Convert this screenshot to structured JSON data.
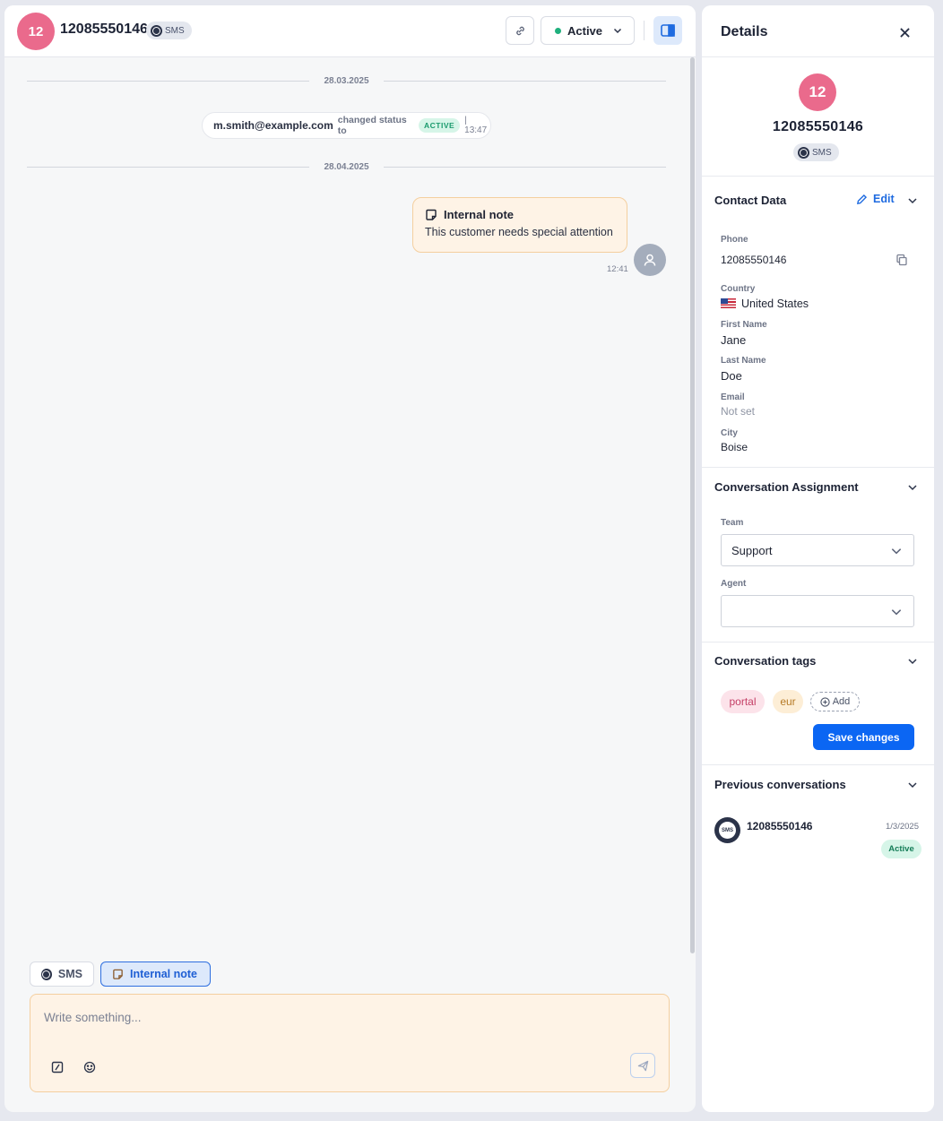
{
  "conversation": {
    "avatar_initials": "12",
    "title": "12085550146",
    "channel_badge": "SMS",
    "status_label": "Active"
  },
  "timeline": {
    "date_1": "28.03.2025",
    "system_message": {
      "actor": "m.smith@example.com",
      "text": "changed status to",
      "status": "ACTIVE",
      "time": "| 13:47"
    },
    "date_2": "28.04.2025",
    "note": {
      "title": "Internal note",
      "text": "This customer needs special attention",
      "time": "12:41"
    }
  },
  "composer": {
    "tab_sms": "SMS",
    "tab_note": "Internal note",
    "placeholder": "Write something..."
  },
  "details": {
    "title": "Details",
    "avatar_initials": "12",
    "number": "12085550146",
    "channel_badge": "SMS",
    "contact": {
      "section_title": "Contact Data",
      "edit_label": "Edit",
      "phone_label": "Phone",
      "phone": "12085550146",
      "country_label": "Country",
      "country": "United States",
      "first_name_label": "First Name",
      "first_name": "Jane",
      "last_name_label": "Last Name",
      "last_name": "Doe",
      "email_label": "Email",
      "email": "Not set",
      "city_label": "City",
      "city": "Boise"
    },
    "assignment": {
      "section_title": "Conversation Assignment",
      "team_label": "Team",
      "team_value": "Support",
      "agent_label": "Agent",
      "agent_value": ""
    },
    "tags": {
      "section_title": "Conversation tags",
      "items": [
        "portal",
        "eur"
      ],
      "add_label": "Add",
      "save_label": "Save changes"
    },
    "previous": {
      "section_title": "Previous conversations",
      "items": [
        {
          "icon_text": "SMS",
          "number": "12085550146",
          "date": "1/3/2025",
          "status": "Active"
        }
      ]
    }
  },
  "colors": {
    "primary": "#0b66f3",
    "avatar": "#ea6a8c",
    "active_green": "#1fb07d",
    "note_bg": "#fef3e6",
    "note_border": "#f4cf9f"
  }
}
